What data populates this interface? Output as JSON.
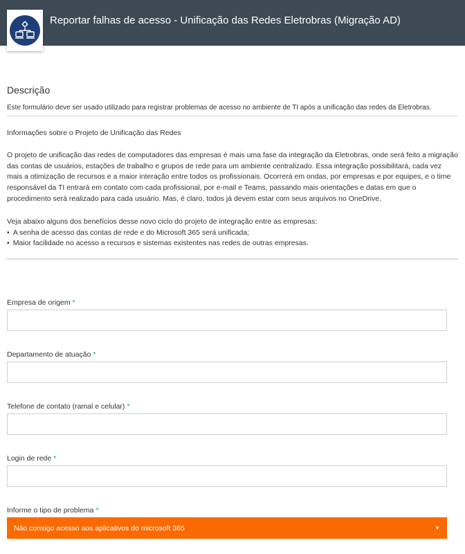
{
  "header": {
    "title": "Reportar falhas de acesso - Unificação das Redes Eletrobras (Migração AD)",
    "logo_icon": "network-computers-icon",
    "bg_color": "#3d4a55"
  },
  "description": {
    "heading": "Descrição",
    "subtitle": "Este formulário deve ser usado utilizado para registrar problemas de acesso no ambiente de TI após a unificação das redes da Eletrobras.",
    "info_title": "Informações sobre o Projeto de Unificação das Redes",
    "paragraph": "O projeto de unificação das redes de computadores das empresas é mais uma fase da integração da Eletrobras, onde será feito a migração das contas de usuários, estações de trabalho e grupos de rede para um ambiente centralizado. Essa integração possibilitará, cada vez mais a otimização de recursos e a maior interação entre todos os profissionais. Ocorrerá em ondas, por empresas e por equipes, e o time responsável da TI entrará em contato com cada profissional, por e-mail e Teams, passando mais orientações e datas em que o procedimento será realizado para cada usuário. Mas, é claro, todos já devem estar com seus arquivos no OneDrive.",
    "benefits_intro": "Veja abaixo alguns dos benefícios desse novo ciclo do projeto de integração entre as empresas:",
    "benefits": [
      "A senha de acesso das contas de rede e do Microsoft 365 será unificada;",
      "Maior facilidade no acesso a recursos e sistemas existentes nas redes de outras empresas."
    ]
  },
  "form": {
    "required_marker": "*",
    "fields": [
      {
        "label": "Empresa de origem",
        "value": ""
      },
      {
        "label": "Departamento de atuação",
        "value": ""
      },
      {
        "label": "Telefone de contato (ramal e celular)",
        "value": ""
      },
      {
        "label": "Login de rede",
        "value": ""
      }
    ],
    "problem_type": {
      "label": "Informe o tipo de problema",
      "selected": "Não consigo acesso aos aplicativos do microsoft 365",
      "accent_color": "#fb6a00"
    }
  }
}
